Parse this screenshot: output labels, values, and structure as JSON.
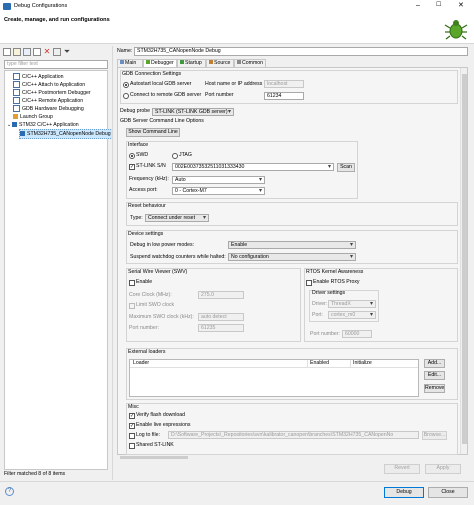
{
  "window": {
    "title": "Debug Configurations"
  },
  "header": {
    "subtitle": "Create, manage, and run configurations"
  },
  "toolbar": {
    "new_label": "New",
    "filter_placeholder": "type filter text"
  },
  "tree": {
    "items": [
      {
        "label": "C/C++ Application"
      },
      {
        "label": "C/C++ Attach to Application"
      },
      {
        "label": "C/C++ Postmortem Debugger"
      },
      {
        "label": "C/C++ Remote Application"
      },
      {
        "label": "GDB Hardware Debugging"
      },
      {
        "label": "Launch Group"
      },
      {
        "label": "STM32 C/C++ Application"
      },
      {
        "label": "STM32H735_CANopenNode Debug"
      }
    ],
    "status": "Filter matched 8 of 8 items"
  },
  "config": {
    "name_label": "Name:",
    "name_value": "STM32H735_CANopenNode Debug",
    "tabs": [
      "Main",
      "Debugger",
      "Startup",
      "Source",
      "Common"
    ]
  },
  "gdb": {
    "group_label": "GDB Connection Settings",
    "autostart_label": "Autostart local GDB server",
    "remote_label": "Connect to remote GDB server",
    "host_label": "Host name or IP address",
    "host_value": "localhost",
    "port_label": "Port number",
    "port_value": "61234"
  },
  "probe": {
    "label": "Debug probe",
    "value": "ST-LINK (ST-LINK GDB server)"
  },
  "server_opts": {
    "label": "GDB Server Command Line Options",
    "show_cmd_button": "Show Command Line"
  },
  "interface": {
    "label": "Interface",
    "swd": "SWD",
    "jtag": "JTAG",
    "stlink_sn_label": "ST-LINK S/N",
    "stlink_sn_value": "002E00373532511031333430",
    "scan_button": "Scan",
    "freq_label": "Frequency (kHz):",
    "freq_value": "Auto",
    "access_label": "Access port:",
    "access_value": "0 - Cortex-M7"
  },
  "reset": {
    "label": "Reset behaviour",
    "type_label": "Type:",
    "type_value": "Connect under reset"
  },
  "device": {
    "label": "Device settings",
    "lowpower_label": "Debug in low power modes:",
    "lowpower_value": "Enable",
    "watchdog_label": "Suspend watchdog counters while halted:",
    "watchdog_value": "No configuration"
  },
  "swv": {
    "label": "Serial Wire Viewer (SWV)",
    "enable": "Enable",
    "core_clock_label": "Core Clock (MHz):",
    "core_clock_value": "275.0",
    "limit_swo": "Limit SWO clock",
    "max_swo_label": "Maximum SWO clock (kHz):",
    "max_swo_value": "auto detect",
    "port_label": "Port number:",
    "port_value": "61235"
  },
  "rtos": {
    "label": "RTOS Kernel Awareness",
    "enable_proxy": "Enable RTOS Proxy",
    "driver_settings": "Driver settings",
    "driver_label": "Driver:",
    "driver_value": "ThreadX",
    "port_label": "Port:",
    "port_value": "cortex_m0",
    "portnum_label": "Port number:",
    "portnum_value": "60000"
  },
  "loaders": {
    "label": "External loaders",
    "columns": [
      "Loader",
      "Enabled",
      "Initialize"
    ],
    "add": "Add...",
    "edit": "Edit...",
    "remove": "Remove"
  },
  "misc": {
    "label": "Misc",
    "verify_flash": "Verify flash download",
    "live_expr": "Enable live expressions",
    "log_to_file": "Log to file:",
    "log_path": "D:\\Software_Projects\\_Repositories\\svn\\kalibrator_canopen\\branches\\STM32H735_CANopenNo",
    "browse": "Browse...",
    "shared_stlink": "Shared ST-LINK"
  },
  "actions": {
    "revert": "Revert",
    "apply": "Apply",
    "debug": "Debug",
    "close": "Close"
  },
  "colors": {
    "selection": "#cce8ff",
    "accent": "#0078d7",
    "bug_green": "#5aa62a"
  }
}
